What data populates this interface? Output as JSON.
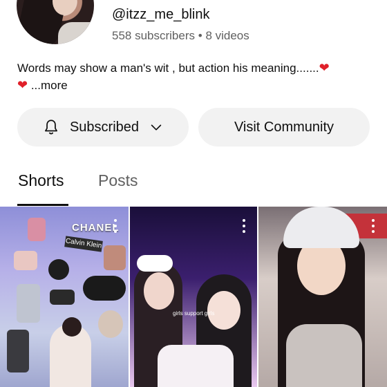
{
  "channel": {
    "handle": "@itzz_me_blink",
    "subscribers": "558 subscribers",
    "separator": "•",
    "videos": "8 videos",
    "description": "Words may show a man's wit , but action his meaning.......",
    "more_label": "...more"
  },
  "buttons": {
    "subscribed_label": "Subscribed",
    "community_label": "Visit Community"
  },
  "tabs": [
    {
      "label": "Shorts",
      "selected": true
    },
    {
      "label": "Posts",
      "selected": false
    }
  ],
  "shorts": [
    {
      "overlay_text": "CHANEL"
    },
    {
      "overlay_text": "girls support girls"
    },
    {
      "overlay_text": ""
    }
  ],
  "colors": {
    "heart": "#e0202a",
    "button_bg": "#f2f2f2",
    "text_secondary": "#606060"
  },
  "icons": {
    "bell": "bell-icon",
    "chevron": "chevron-down-icon",
    "heart": "heart-emoji",
    "more": "more-vert-icon"
  }
}
